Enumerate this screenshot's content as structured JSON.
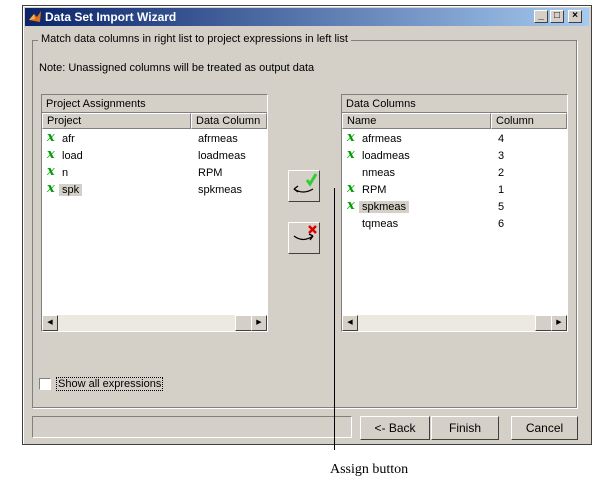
{
  "window": {
    "title": "Data Set Import Wizard",
    "controls": {
      "minimize": "_",
      "maximize": "□",
      "close": "×"
    }
  },
  "group_label": "Match data columns in right list to project expressions in left list",
  "note": "Note: Unassigned columns will be treated as output data",
  "left_panel": {
    "title": "Project Assignments",
    "headers": [
      "Project",
      "Data Column"
    ],
    "rows": [
      {
        "assigned": true,
        "icon": "x",
        "project": "afr",
        "column": "afrmeas"
      },
      {
        "assigned": true,
        "icon": "x",
        "project": "load",
        "column": "loadmeas"
      },
      {
        "assigned": true,
        "icon": "x",
        "project": "n",
        "column": "RPM"
      },
      {
        "assigned": true,
        "icon": "x",
        "project": "spk",
        "column": "spkmeas"
      }
    ],
    "selected_row": 3
  },
  "right_panel": {
    "title": "Data Columns",
    "headers": [
      "Name",
      "Column"
    ],
    "rows": [
      {
        "assigned": true,
        "icon": "x",
        "name": "afrmeas",
        "column": "4"
      },
      {
        "assigned": true,
        "icon": "x",
        "name": "loadmeas",
        "column": "3"
      },
      {
        "assigned": false,
        "icon": "",
        "name": "nmeas",
        "column": "2"
      },
      {
        "assigned": true,
        "icon": "x",
        "name": "RPM",
        "column": "1"
      },
      {
        "assigned": true,
        "icon": "x",
        "name": "spkmeas",
        "column": "5"
      },
      {
        "assigned": false,
        "icon": "",
        "name": "tqmeas",
        "column": "6"
      }
    ],
    "selected_row": 4
  },
  "checkbox": {
    "label": "Show all expressions",
    "checked": false
  },
  "buttons": {
    "back": "<- Back",
    "finish": "Finish",
    "cancel": "Cancel"
  },
  "callout": "Assign button",
  "colors": {
    "assigned_icon": "#00a000",
    "assign_check": "#33cc33",
    "unassign_x": "#dd0000",
    "title_bar": "#0a246a"
  }
}
